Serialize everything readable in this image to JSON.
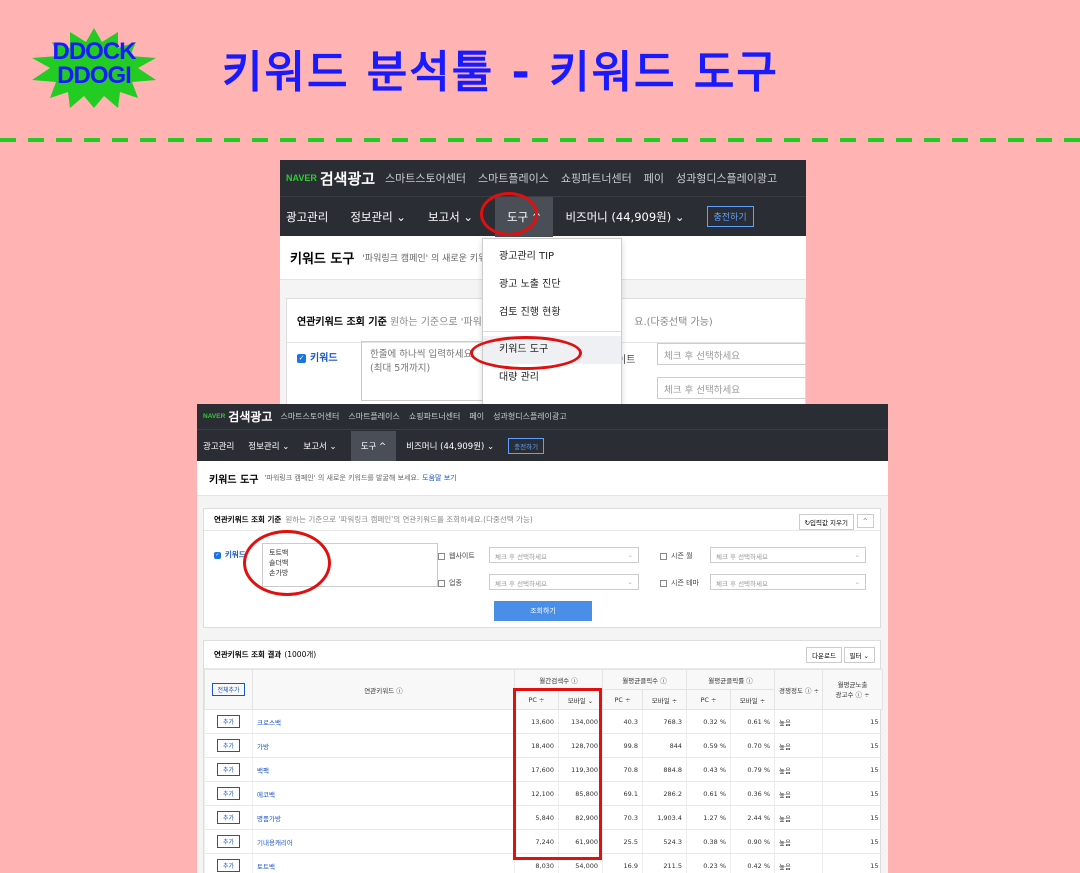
{
  "banner": {
    "logo_text": "DDOCK\nDDOGI",
    "title": "키워드 분석툴 - 키워드 도구"
  },
  "colors": {
    "accent_red": "#e01010",
    "naver_green": "#2dce2d",
    "title_blue": "#1a1aff",
    "dash_green": "#22cc22"
  },
  "shot1": {
    "naver": "NAVER",
    "brand": "검색광고",
    "top_links": [
      "스마트스토어센터",
      "스마트플레이스",
      "쇼핑파트너센터",
      "페이",
      "성과형디스플레이광고"
    ],
    "menu": [
      "광고관리",
      "정보관리 ⌄",
      "보고서 ⌄",
      "도구 ^",
      "비즈머니 (44,909원) ⌄"
    ],
    "charge": "충전하기",
    "page_title": "키워드 도구",
    "page_sub": "'파워링크 캠페인' 의 새로운 키워",
    "panel_title": "연관키워드 조회 기준",
    "panel_sub_a": "원하는 기준으로 '파워링",
    "panel_sub_b": "요.(다중선택 가능)",
    "kw_label": "키워드",
    "ta_placeholder_1": "한줄에 하나씩 입력하세요.",
    "ta_placeholder_2": "(최대 5개까지)",
    "site_label": "이트",
    "sel_placeholder": "체크 후 선택하세요",
    "dropdown": [
      "광고관리 TIP",
      "광고 노출 진단",
      "검토 진행 현황",
      "키워드 도구",
      "대량 관리"
    ]
  },
  "shot2": {
    "naver": "NAVER",
    "brand": "검색광고",
    "top_links": [
      "스마트스토어센터",
      "스마트플레이스",
      "쇼핑파트너센터",
      "페이",
      "성과형디스플레이광고"
    ],
    "menu": [
      "광고관리",
      "정보관리 ⌄",
      "보고서 ⌄",
      "도구 ^",
      "비즈머니 (44,909원) ⌄"
    ],
    "charge": "충전하기",
    "page_title": "키워드 도구",
    "page_sub": "'파워링크 캠페인' 의 새로운 키워드를 발굴해 보세요.",
    "help_link": "도움말 보기",
    "criteria_title": "연관키워드 조회 기준",
    "criteria_sub": "원하는 기준으로 '파워링크 캠페인'의 연관키워드를 조회하세요.(다중선택 가능)",
    "reset": "↻입력값 지우기",
    "fold": "^",
    "kw_label": "키워드",
    "keywords_text": "토트백\n숄더백\n손가방",
    "opt_website": "웹사이트",
    "opt_industry": "업종",
    "opt_season_month": "시즌 월",
    "opt_season_theme": "시즌 테마",
    "sel_placeholder": "체크 후 선택하세요",
    "search_btn": "조회하기",
    "result_title": "연관키워드 조회 결과",
    "result_count": "(1000개)",
    "download": "다운로드",
    "filter": "필터 ⌄",
    "headers": {
      "add_all": "전체추가",
      "keyword": "연관키워드 ⓘ",
      "monthly_search": "월간검색수 ⓘ",
      "avg_clicks": "월평균클릭수 ⓘ",
      "avg_ctr": "월평균클릭률 ⓘ",
      "competition": "경쟁정도 ⓘ ÷",
      "ad_count": "월평균노출\n광고수 ⓘ ÷",
      "pc": "PC ÷",
      "mobile": "모바일 ÷",
      "mobile_sorted": "모바일 ⌄"
    },
    "add_label": "추가",
    "rows": [
      [
        "크로스백",
        "13,600",
        "134,000",
        "40.3",
        "768.3",
        "0.32 %",
        "0.61 %",
        "높음",
        "15"
      ],
      [
        "가방",
        "18,400",
        "128,700",
        "99.8",
        "844",
        "0.59 %",
        "0.70 %",
        "높음",
        "15"
      ],
      [
        "백팩",
        "17,600",
        "119,300",
        "70.8",
        "884.8",
        "0.43 %",
        "0.79 %",
        "높음",
        "15"
      ],
      [
        "에코백",
        "12,100",
        "85,800",
        "69.1",
        "286.2",
        "0.61 %",
        "0.36 %",
        "높음",
        "15"
      ],
      [
        "명품가방",
        "5,840",
        "82,900",
        "70.3",
        "1,903.4",
        "1.27 %",
        "2.44 %",
        "높음",
        "15"
      ],
      [
        "기내용캐리어",
        "7,240",
        "61,900",
        "25.5",
        "524.3",
        "0.38 %",
        "0.90 %",
        "높음",
        "15"
      ],
      [
        "토트백",
        "8,030",
        "54,000",
        "16.9",
        "211.5",
        "0.23 %",
        "0.42 %",
        "높음",
        "15"
      ]
    ]
  }
}
